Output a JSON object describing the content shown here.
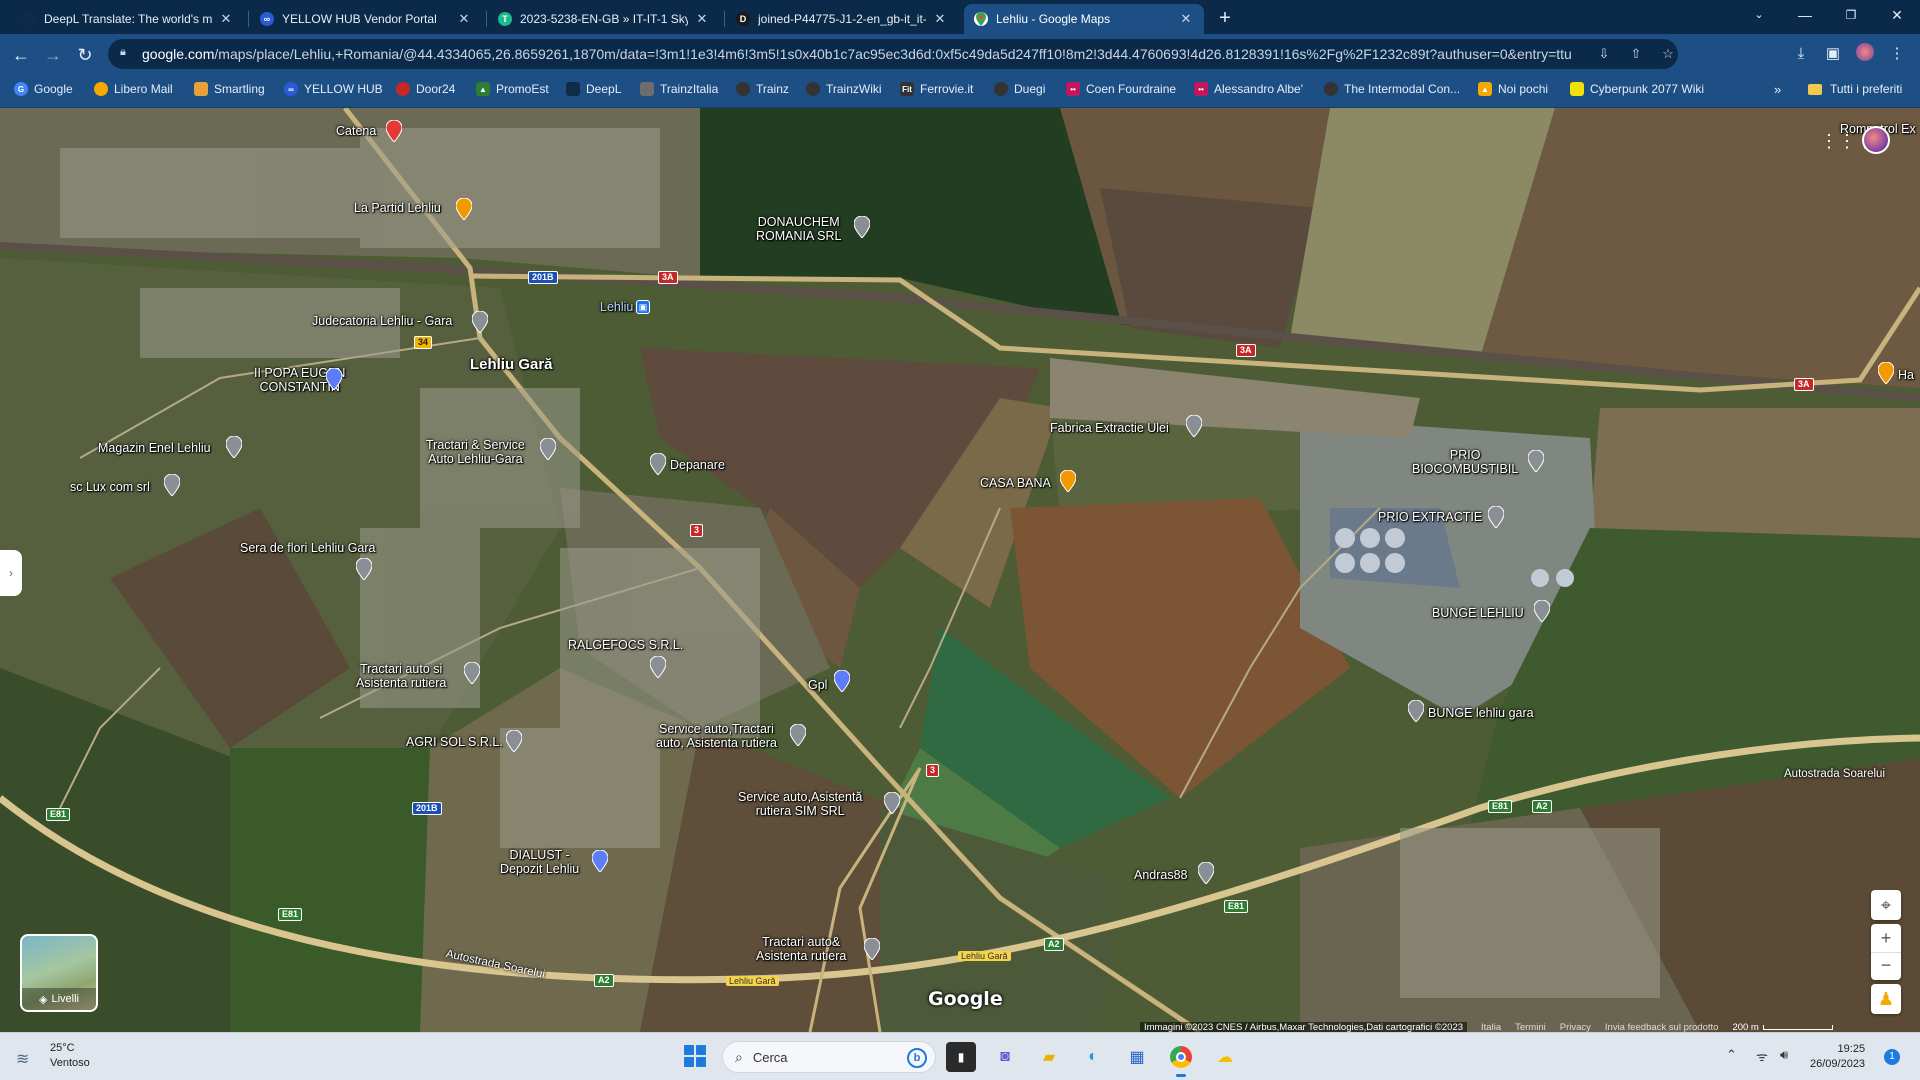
{
  "browser": {
    "tabs": [
      {
        "title": "DeepL Translate: The world's mo",
        "icon": "deepl-icon",
        "color": "#0f2b46",
        "active": false
      },
      {
        "title": "YELLOW HUB Vendor Portal",
        "icon": "yellowhub-icon",
        "color": "#2a5bd7",
        "active": false
      },
      {
        "title": "2023-5238-EN-GB » IT-IT-1 Skyt",
        "icon": "smartcat-icon",
        "color": "#1db98a",
        "active": false
      },
      {
        "title": "joined-P44775-J1-2-en_gb-it_it-",
        "icon": "document-icon",
        "color": "#1a1a1a",
        "active": false
      },
      {
        "title": "Lehliu - Google Maps",
        "icon": "google-maps-icon",
        "color": "#34a853",
        "active": true
      }
    ],
    "new_tab": "+",
    "url_host": "google.com",
    "url_path": "/maps/place/Lehliu,+Romania/@44.4334065,26.8659261,1870m/data=!3m1!1e3!4m6!3m5!1s0x40b1c7ac95ec3d6d:0xf5c49da5d247ff10!8m2!3d44.4760693!4d26.8128391!16s%2Fg%2F1232c89t?authuser=0&entry=ttu",
    "bookmarks": [
      {
        "label": "Google",
        "color": "#4285f4"
      },
      {
        "label": "Libero Mail",
        "color": "#f2a900"
      },
      {
        "label": "Smartling",
        "color": "#e8a13a"
      },
      {
        "label": "YELLOW HUB",
        "color": "#2a5bd7"
      },
      {
        "label": "Door24",
        "color": "#c62828"
      },
      {
        "label": "PromoEst",
        "color": "#2e7d32"
      },
      {
        "label": "DeepL",
        "color": "#0f2b46"
      },
      {
        "label": "TrainzItalia",
        "color": "#6d6d6d"
      },
      {
        "label": "Trainz",
        "color": "#333333"
      },
      {
        "label": "TrainzWiki",
        "color": "#333333"
      },
      {
        "label": "Ferrovie.it",
        "color": "#333333"
      },
      {
        "label": "Duegi",
        "color": "#333333"
      },
      {
        "label": "Coen Fourdraine",
        "color": "#c2185b"
      },
      {
        "label": "Alessandro Albe'",
        "color": "#c2185b"
      },
      {
        "label": "The Intermodal Con...",
        "color": "#333333"
      },
      {
        "label": "Noi pochi",
        "color": "#f2a900"
      },
      {
        "label": "Cyberpunk 2077 Wiki",
        "color": "#f2e200"
      }
    ],
    "bookmarks_more": "»",
    "bookmarks_folder": "Tutti i preferiti"
  },
  "map": {
    "labels": [
      {
        "text": "Catena"
      },
      {
        "text": "La Partid Lehliu"
      },
      {
        "text": "DONAUCHEM\nROMANIA SRL"
      },
      {
        "text": "Lehliu"
      },
      {
        "text": "Judecatoria Lehliu - Gara"
      },
      {
        "text": "Lehliu Gară"
      },
      {
        "text": "II POPA EUGEN\nCONSTANTIN"
      },
      {
        "text": "Tractari & Service\nAuto Lehliu-Gara"
      },
      {
        "text": "Depanare"
      },
      {
        "text": "Magazin Enel Lehliu"
      },
      {
        "text": "sc Lux com srl"
      },
      {
        "text": "Fabrica Extractie Ulei"
      },
      {
        "text": "CASA BANA"
      },
      {
        "text": "PRIO\nBIOCOMBUSTIBIL"
      },
      {
        "text": "PRIO EXTRACTIE"
      },
      {
        "text": "Sera de flori Lehliu Gara"
      },
      {
        "text": "BUNGE LEHLIU"
      },
      {
        "text": "RALGEFOCS S.R.L."
      },
      {
        "text": "Gpl"
      },
      {
        "text": "Tractari auto si\nAsistenta rutiera"
      },
      {
        "text": "BUNGE lehliu gara"
      },
      {
        "text": "AGRI SOL S.R.L."
      },
      {
        "text": "Service auto,Tractari\nauto, Asistenta rutiera"
      },
      {
        "text": "Service auto,Asistentă\nrutiera SIM SRL"
      },
      {
        "text": "DIALUST -\nDepozit Lehliu"
      },
      {
        "text": "Andras88"
      },
      {
        "text": "Tractari auto&\nAsistenta rutiera"
      },
      {
        "text": "Ha"
      },
      {
        "text": "Rompetrol Ex"
      }
    ],
    "shields": [
      "201B",
      "3A",
      "34",
      "3A",
      "3A",
      "3",
      "3",
      "E81",
      "201B",
      "E81",
      "E81",
      "A2",
      "A2",
      "E81",
      "A2"
    ],
    "road_names": [
      "Autostrada Soarelui",
      "Autostrada Soarelui"
    ],
    "place_signs": [
      "Lehliu Gară",
      "Lehliu Gară"
    ],
    "layers_label": "Livelli",
    "google_logo": "Google",
    "attribution": "Immagini ©2023 CNES / Airbus,Maxar Technologies,Dati cartografici ©2023",
    "attribution_links": [
      "Italia",
      "Termini",
      "Privacy",
      "Invia feedback sul prodotto"
    ],
    "scale_label": "200 m"
  },
  "taskbar": {
    "temperature": "25°C",
    "weather": "Ventoso",
    "search_placeholder": "Cerca",
    "time": "19:25",
    "date": "26/09/2023",
    "notifications": "1"
  }
}
